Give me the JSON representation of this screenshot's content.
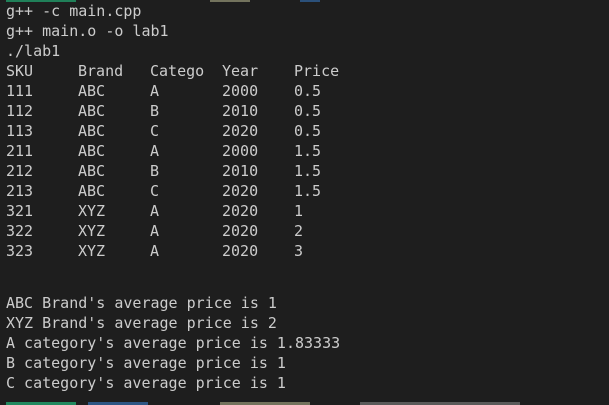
{
  "colors": {
    "background": "#1e1e1e",
    "text": "#cccccc",
    "prompt_green": "#23d18b",
    "prompt_yellow": "#dcdcaa",
    "prompt_blue": "#3b8eea"
  },
  "commands": [
    "g++ -c main.cpp",
    "g++ main.o -o lab1",
    "./lab1"
  ],
  "table": {
    "headers": [
      "SKU",
      "Brand",
      "Catego",
      "Year",
      "Price"
    ],
    "rows": [
      [
        "111",
        "ABC",
        "A",
        "2000",
        "0.5"
      ],
      [
        "112",
        "ABC",
        "B",
        "2010",
        "0.5"
      ],
      [
        "113",
        "ABC",
        "C",
        "2020",
        "0.5"
      ],
      [
        "211",
        "ABC",
        "A",
        "2000",
        "1.5"
      ],
      [
        "212",
        "ABC",
        "B",
        "2010",
        "1.5"
      ],
      [
        "213",
        "ABC",
        "C",
        "2020",
        "1.5"
      ],
      [
        "321",
        "XYZ",
        "A",
        "2020",
        "1"
      ],
      [
        "322",
        "XYZ",
        "A",
        "2020",
        "2"
      ],
      [
        "323",
        "XYZ",
        "A",
        "2020",
        "3"
      ]
    ]
  },
  "results": [
    "ABC Brand's average price is 1",
    "XYZ Brand's average price is 2",
    "A category's average price is 1.83333",
    "B category's average price is 1",
    "C category's average price is 1"
  ]
}
